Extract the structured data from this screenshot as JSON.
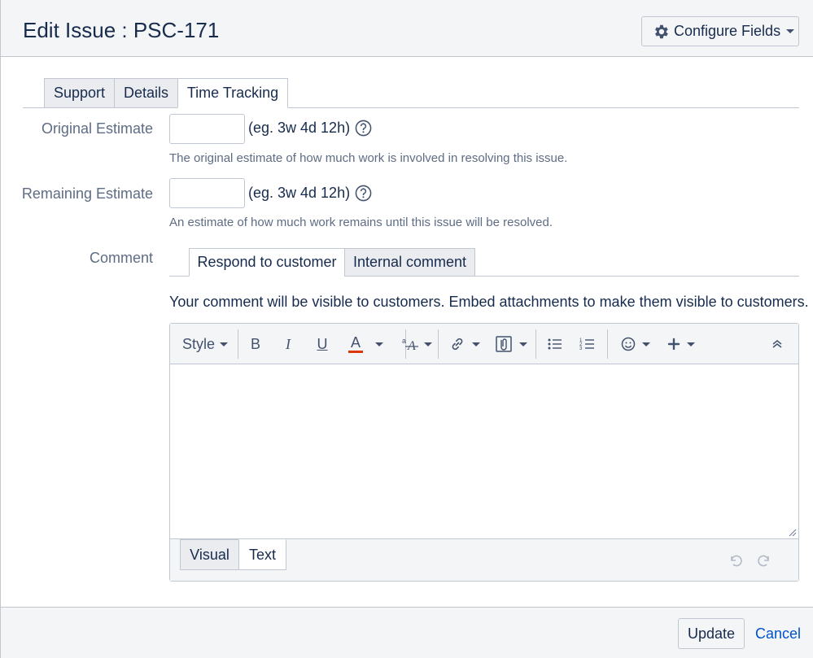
{
  "header": {
    "title": "Edit Issue : PSC-171",
    "configure_label": "Configure Fields"
  },
  "tabs": [
    {
      "label": "Support",
      "active": false
    },
    {
      "label": "Details",
      "active": false
    },
    {
      "label": "Time Tracking",
      "active": true
    }
  ],
  "fields": {
    "original_estimate": {
      "label": "Original Estimate",
      "value": "",
      "hint": "(eg. 3w 4d 12h)",
      "description": "The original estimate of how much work is involved in resolving this issue."
    },
    "remaining_estimate": {
      "label": "Remaining Estimate",
      "value": "",
      "hint": "(eg. 3w 4d 12h)",
      "description": "An estimate of how much work remains until this issue will be resolved."
    }
  },
  "comment": {
    "label": "Comment",
    "tabs": [
      {
        "label": "Respond to customer",
        "active": true
      },
      {
        "label": "Internal comment",
        "active": false
      }
    ],
    "visibility_message": "Your comment will be visible to customers. Embed attachments to make them visible to customers.",
    "toolbar": {
      "style_label": "Style",
      "bold": "B",
      "italic": "I",
      "underline": "U",
      "text_color": "A",
      "text_color_underline": "#de350b"
    },
    "value": "",
    "mode_tabs": [
      {
        "label": "Visual",
        "active": false
      },
      {
        "label": "Text",
        "active": true
      }
    ]
  },
  "footer": {
    "update_label": "Update",
    "cancel_label": "Cancel"
  },
  "colors": {
    "link": "#0052cc",
    "header_bg": "#f4f5f7",
    "border": "#c1c7d0"
  }
}
